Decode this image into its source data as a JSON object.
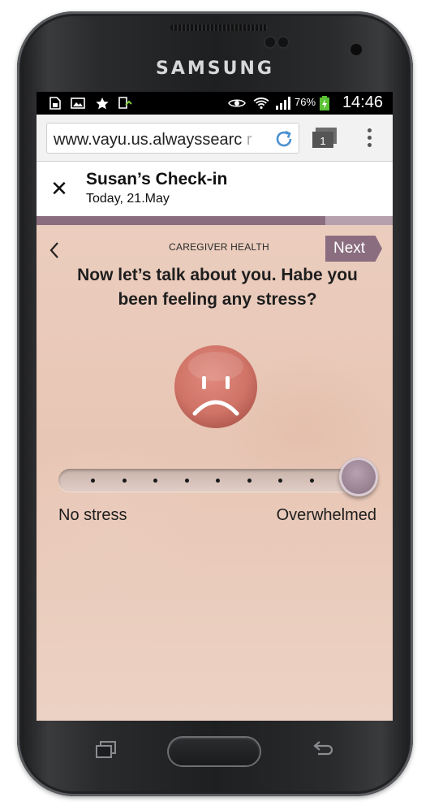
{
  "device": {
    "brand": "SAMSUNG"
  },
  "status_bar": {
    "battery_percent": "76%",
    "time": "14:46",
    "icons": [
      "sim-card-icon",
      "image-icon",
      "star-icon",
      "upload-icon",
      "eye-icon",
      "wifi-icon",
      "signal-icon",
      "battery-charging-icon"
    ]
  },
  "browser": {
    "url": "www.vayu.us.alwayssearc",
    "url_fade": "r",
    "tab_count": "1"
  },
  "header": {
    "title": "Susan’s Check-in",
    "subtitle": "Today, 21.May"
  },
  "progress": {
    "fraction": 0.81,
    "fill_color": "#8a6d7f",
    "track_color": "#b6a0ad"
  },
  "screen": {
    "section_label": "CAREGIVER HEALTH",
    "next_label": "Next",
    "question": "Now let’s talk about you. Habe you been feeling any stress?",
    "face": {
      "icon": "sad-face-icon",
      "color": "#d07367"
    },
    "slider": {
      "positions": 9,
      "selected_index": 8,
      "value_fraction": 1.0,
      "min_label": "No stress",
      "max_label": "Overwhelmed"
    }
  }
}
